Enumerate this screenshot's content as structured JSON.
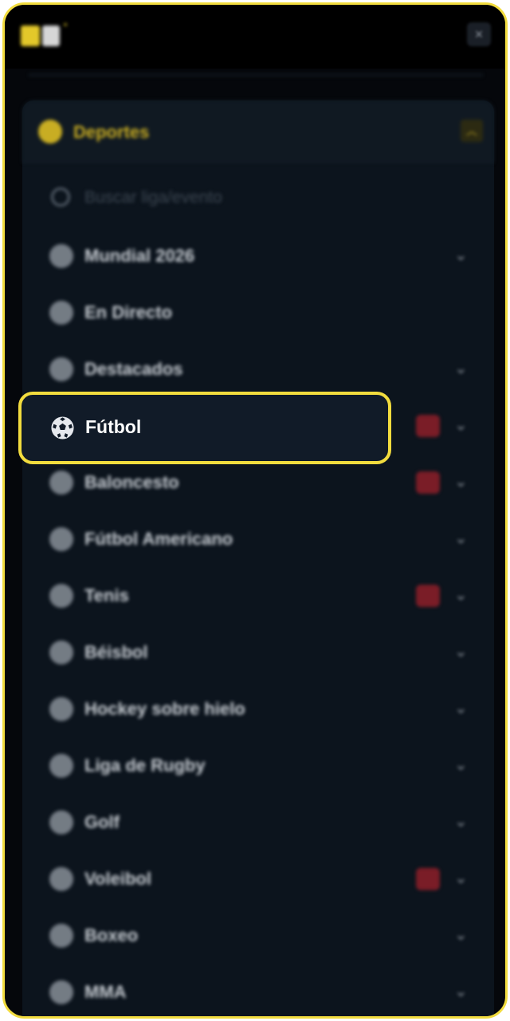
{
  "header": {
    "close_glyph": "×",
    "logo_star": "•"
  },
  "sports_panel": {
    "title": "Deportes",
    "collapse_glyph": "︿",
    "search_placeholder": "Buscar liga/evento"
  },
  "menu": {
    "chevron": "⌄",
    "items": [
      {
        "label": "Mundial 2026",
        "icon": "trophy-icon",
        "has_badge": false,
        "has_chevron": true
      },
      {
        "label": "En Directo",
        "icon": "live-icon",
        "has_badge": false,
        "has_chevron": false
      },
      {
        "label": "Destacados",
        "icon": "star-icon",
        "has_badge": false,
        "has_chevron": true
      },
      {
        "label": "Fútbol",
        "icon": "soccer-ball-icon",
        "has_badge": true,
        "has_chevron": true,
        "highlighted": true
      },
      {
        "label": "Baloncesto",
        "icon": "basketball-icon",
        "has_badge": true,
        "has_chevron": true
      },
      {
        "label": "Fútbol Americano",
        "icon": "american-football-icon",
        "has_badge": false,
        "has_chevron": true
      },
      {
        "label": "Tenis",
        "icon": "tennis-ball-icon",
        "has_badge": true,
        "has_chevron": true
      },
      {
        "label": "Béisbol",
        "icon": "baseball-icon",
        "has_badge": false,
        "has_chevron": true
      },
      {
        "label": "Hockey sobre hielo",
        "icon": "hockey-stick-icon",
        "has_badge": false,
        "has_chevron": true
      },
      {
        "label": "Liga de Rugby",
        "icon": "rugby-ball-icon",
        "has_badge": false,
        "has_chevron": true
      },
      {
        "label": "Golf",
        "icon": "golf-icon",
        "has_badge": false,
        "has_chevron": true
      },
      {
        "label": "Voleibol",
        "icon": "volleyball-icon",
        "has_badge": true,
        "has_chevron": true
      },
      {
        "label": "Boxeo",
        "icon": "boxing-glove-icon",
        "has_badge": false,
        "has_chevron": true
      },
      {
        "label": "MMA",
        "icon": "mma-icon",
        "has_badge": false,
        "has_chevron": true
      }
    ]
  },
  "colors": {
    "accent": "#f2dc3e",
    "badge": "#7a1d27",
    "panel": "#0c141d"
  }
}
